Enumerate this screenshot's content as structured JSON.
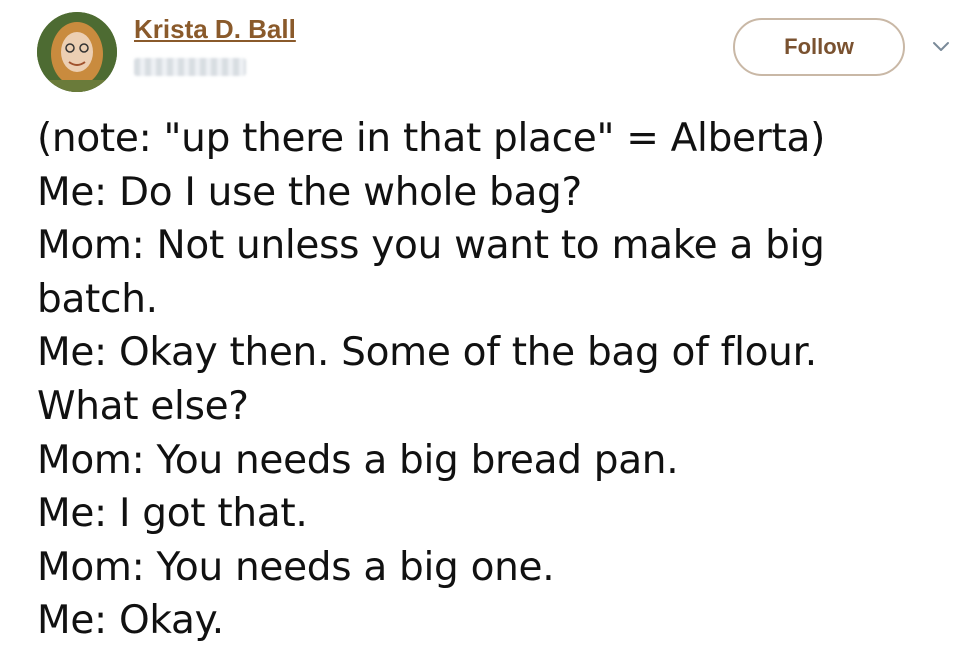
{
  "author": {
    "display_name": "Krista D. Ball"
  },
  "header": {
    "follow_label": "Follow",
    "menu_icon": "chevron-down-icon",
    "avatar_icon": "user-avatar"
  },
  "tweet": {
    "lines": [
      "(note: \"up there in that place\" = Alberta)",
      "Me: Do I use the whole bag?",
      "Mom: Not unless you want to make a big",
      "batch.",
      "Me: Okay then. Some of the bag of flour.",
      "What else?",
      "Mom: You needs a big bread pan.",
      "Me: I got that.",
      "Mom: You needs a big one.",
      "Me: Okay."
    ]
  },
  "colors": {
    "name_link": "#8a5a2b",
    "follow_text": "#7a5230",
    "follow_border": "#c9b8a6",
    "text": "#111111"
  }
}
